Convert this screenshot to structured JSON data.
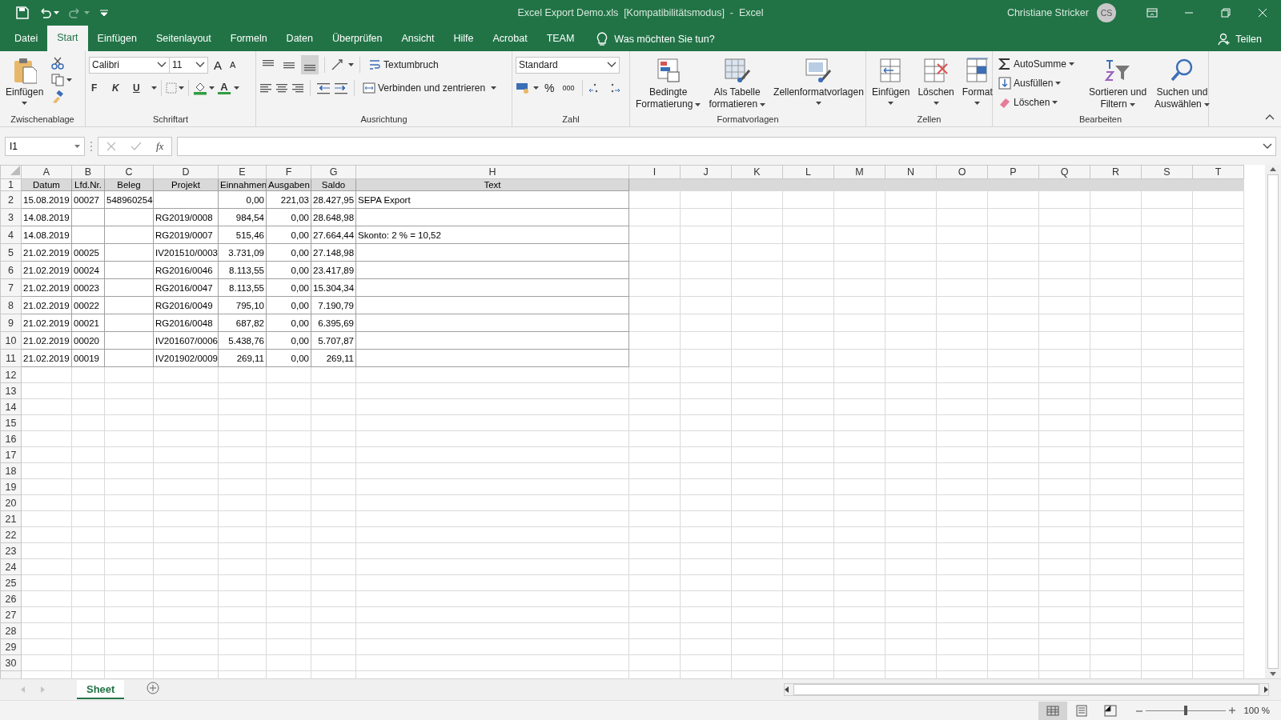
{
  "title_bar": {
    "title": "Excel Export Demo.xls  [Kompatibilitätsmodus]  -  Excel",
    "user": "Christiane Stricker",
    "avatar": "CS"
  },
  "tabs": [
    {
      "label": "Datei",
      "selected": false
    },
    {
      "label": "Start",
      "selected": true
    },
    {
      "label": "Einfügen",
      "selected": false
    },
    {
      "label": "Seitenlayout",
      "selected": false
    },
    {
      "label": "Formeln",
      "selected": false
    },
    {
      "label": "Daten",
      "selected": false
    },
    {
      "label": "Überprüfen",
      "selected": false
    },
    {
      "label": "Ansicht",
      "selected": false
    },
    {
      "label": "Hilfe",
      "selected": false
    },
    {
      "label": "Acrobat",
      "selected": false
    },
    {
      "label": "TEAM",
      "selected": false
    }
  ],
  "tell_me": {
    "placeholder": "Was möchten Sie tun?"
  },
  "share": "Teilen",
  "ribbon": [
    {
      "kind": "clipboard",
      "label": "Zwischenablage",
      "paste": "Einfügen"
    },
    {
      "kind": "font",
      "label": "Schriftart",
      "font_name": "Calibri",
      "font_size": "11",
      "grow": "A",
      "shrink": "A",
      "bold": "F",
      "italic": "K",
      "underline": "U",
      "font_color": "A"
    },
    {
      "kind": "alignment",
      "label": "Ausrichtung",
      "vertical": [
        {
          "selected": false
        },
        {
          "selected": false
        },
        {
          "selected": true
        }
      ],
      "wrap": "Textumbruch",
      "merge": "Verbinden und zentrieren"
    },
    {
      "kind": "number",
      "label": "Zahl",
      "format": "Standard",
      "percent": "%",
      "thousands": "000"
    },
    {
      "kind": "styles",
      "label": "Formatvorlagen",
      "buttons": [
        {
          "lines": [
            "Bedingte",
            "Formatierung"
          ]
        },
        {
          "lines": [
            "Als Tabelle",
            "formatieren"
          ]
        },
        {
          "lines": [
            "Zellenformatvorlagen"
          ]
        }
      ]
    },
    {
      "kind": "cells",
      "label": "Zellen",
      "buttons": [
        {
          "lines": [
            "Einfügen"
          ]
        },
        {
          "lines": [
            "Löschen"
          ]
        },
        {
          "lines": [
            "Format"
          ]
        }
      ]
    },
    {
      "kind": "editing",
      "label": "Bearbeiten",
      "small": [
        "AutoSumme",
        "Ausfüllen",
        "Löschen"
      ],
      "buttons": [
        {
          "lines": [
            "Sortieren und",
            "Filtern"
          ]
        },
        {
          "lines": [
            "Suchen und",
            "Auswählen"
          ]
        }
      ]
    }
  ],
  "formula_bar": {
    "name_box": "I1",
    "function": "fx"
  },
  "grid": {
    "columns": [
      "A",
      "B",
      "C",
      "D",
      "E",
      "F",
      "G",
      "H",
      "I",
      "J",
      "K",
      "L",
      "M",
      "N",
      "O",
      "P",
      "Q",
      "R",
      "S",
      "T"
    ],
    "rows": [
      {
        "number": "1",
        "kind": "header",
        "cells": [
          "Datum",
          "Lfd.Nr.",
          "Beleg",
          "Projekt",
          "Einnahmen",
          "Ausgaben",
          "Saldo",
          "Text"
        ]
      },
      {
        "number": "2",
        "kind": "data",
        "cells": [
          "15.08.2019",
          "00027",
          "548960254",
          null,
          "0,00",
          "221,03",
          "28.427,95",
          "SEPA Export"
        ]
      },
      {
        "number": "3",
        "kind": "data",
        "cells": [
          "14.08.2019",
          null,
          null,
          "RG2019/0008",
          "984,54",
          "0,00",
          "28.648,98",
          null
        ]
      },
      {
        "number": "4",
        "kind": "data",
        "cells": [
          "14.08.2019",
          null,
          null,
          "RG2019/0007",
          "515,46",
          "0,00",
          "27.664,44",
          "Skonto: 2 % = 10,52"
        ]
      },
      {
        "number": "5",
        "kind": "data",
        "cells": [
          "21.02.2019",
          "00025",
          null,
          "IV201510/0003",
          "3.731,09",
          "0,00",
          "27.148,98",
          null
        ]
      },
      {
        "number": "6",
        "kind": "data",
        "cells": [
          "21.02.2019",
          "00024",
          null,
          "RG2016/0046",
          "8.113,55",
          "0,00",
          "23.417,89",
          null
        ]
      },
      {
        "number": "7",
        "kind": "data",
        "cells": [
          "21.02.2019",
          "00023",
          null,
          "RG2016/0047",
          "8.113,55",
          "0,00",
          "15.304,34",
          null
        ]
      },
      {
        "number": "8",
        "kind": "data",
        "cells": [
          "21.02.2019",
          "00022",
          null,
          "RG2016/0049",
          "795,10",
          "0,00",
          "7.190,79",
          null
        ]
      },
      {
        "number": "9",
        "kind": "data",
        "cells": [
          "21.02.2019",
          "00021",
          null,
          "RG2016/0048",
          "687,82",
          "0,00",
          "6.395,69",
          null
        ]
      },
      {
        "number": "10",
        "kind": "data",
        "cells": [
          "21.02.2019",
          "00020",
          null,
          "IV201607/0006",
          "5.438,76",
          "0,00",
          "5.707,87",
          null
        ]
      },
      {
        "number": "11",
        "kind": "data",
        "cells": [
          "21.02.2019",
          "00019",
          null,
          "IV201902/0009",
          "269,11",
          "0,00",
          "269,11",
          null
        ]
      },
      {
        "number": "12",
        "kind": "empty"
      },
      {
        "number": "13",
        "kind": "empty"
      },
      {
        "number": "14",
        "kind": "empty"
      },
      {
        "number": "15",
        "kind": "empty"
      },
      {
        "number": "16",
        "kind": "empty"
      },
      {
        "number": "17",
        "kind": "empty"
      },
      {
        "number": "18",
        "kind": "empty"
      },
      {
        "number": "19",
        "kind": "empty"
      },
      {
        "number": "20",
        "kind": "empty"
      },
      {
        "number": "21",
        "kind": "empty"
      },
      {
        "number": "22",
        "kind": "empty"
      },
      {
        "number": "23",
        "kind": "empty"
      },
      {
        "number": "24",
        "kind": "empty"
      },
      {
        "number": "25",
        "kind": "empty"
      },
      {
        "number": "26",
        "kind": "empty"
      },
      {
        "number": "27",
        "kind": "empty"
      },
      {
        "number": "28",
        "kind": "empty"
      },
      {
        "number": "29",
        "kind": "empty"
      },
      {
        "number": "30",
        "kind": "empty"
      }
    ]
  },
  "sheet_tabs": [
    {
      "label": "Sheet",
      "selected": true
    }
  ],
  "status_bar": {
    "views": [
      {
        "kind": "normal",
        "selected": true
      },
      {
        "kind": "page_layout",
        "selected": false
      },
      {
        "kind": "page_break",
        "selected": false
      }
    ],
    "zoom": {
      "label": "100 %",
      "level": 0.5
    }
  }
}
